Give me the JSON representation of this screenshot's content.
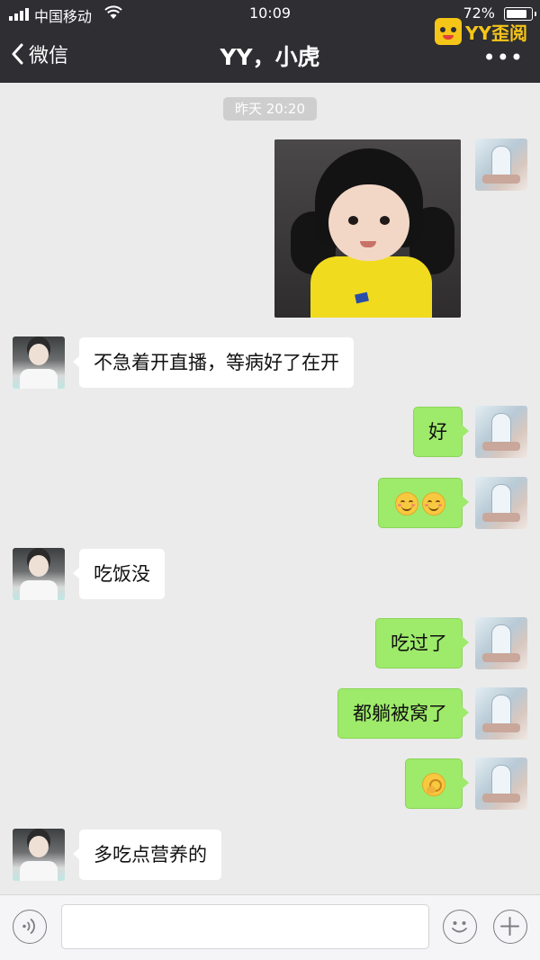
{
  "status_bar": {
    "carrier": "中国移动",
    "time": "10:09",
    "battery": "72%",
    "battery_level": 0.72
  },
  "nav": {
    "back_label": "微信",
    "title": "YY，小虎",
    "more": "•••"
  },
  "watermark": {
    "text": "YY歪阅"
  },
  "chat": {
    "timestamp": "昨天 20:20",
    "messages": [
      {
        "side": "me",
        "type": "image"
      },
      {
        "side": "other",
        "text": "不急着开直播，等病好了在开"
      },
      {
        "side": "me",
        "text": "好"
      },
      {
        "side": "me",
        "emoji": [
          "smile-blush-emoji",
          "smile-blush-emoji"
        ]
      },
      {
        "side": "other",
        "text": "吃饭没"
      },
      {
        "side": "me",
        "text": "吃过了"
      },
      {
        "side": "me",
        "text": "都躺被窝了"
      },
      {
        "side": "me",
        "emoji": [
          "hand-gesture-emoji"
        ]
      },
      {
        "side": "other",
        "text": "多吃点营养的"
      }
    ]
  },
  "input_bar": {
    "placeholder": "",
    "icons": [
      "voice-icon",
      "emoji-icon",
      "plus-icon"
    ]
  },
  "colors": {
    "nav_bg": "#2e2e33",
    "chat_bg": "#ebebeb",
    "my_bubble": "#9eea6a",
    "other_bubble": "#ffffff",
    "watermark": "#f5c518"
  }
}
